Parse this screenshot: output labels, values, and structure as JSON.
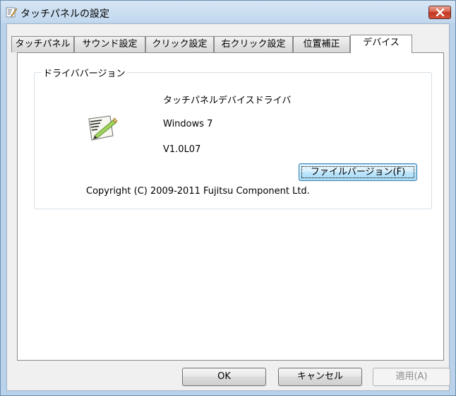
{
  "window": {
    "title": "タッチパネルの設定"
  },
  "tabs": [
    {
      "label": "タッチパネル",
      "active": false
    },
    {
      "label": "サウンド設定",
      "active": false
    },
    {
      "label": "クリック設定",
      "active": false
    },
    {
      "label": "右クリック設定",
      "active": false
    },
    {
      "label": "位置補正",
      "active": false
    },
    {
      "label": "デバイス",
      "active": true
    }
  ],
  "group": {
    "title": "ドライババージョン"
  },
  "driver": {
    "name": "タッチパネルデバイスドライバ",
    "os": "Windows 7",
    "version": "V1.0L07"
  },
  "buttons": {
    "file_version": "ファイルバージョン(F)",
    "ok": "OK",
    "cancel": "キャンセル",
    "apply": "適用(A)"
  },
  "copyright": "Copyright (C) 2009-2011 Fujitsu Component Ltd.",
  "icons": {
    "title": "settings-app-icon",
    "driver": "driver-document-icon",
    "close": "close-icon"
  },
  "colors": {
    "title_bar": "#c2d8ee",
    "close_button": "#c7402a",
    "client_bg": "#f0f0f0",
    "panel_bg": "#ffffff",
    "focused_button": "#bee6fd"
  }
}
